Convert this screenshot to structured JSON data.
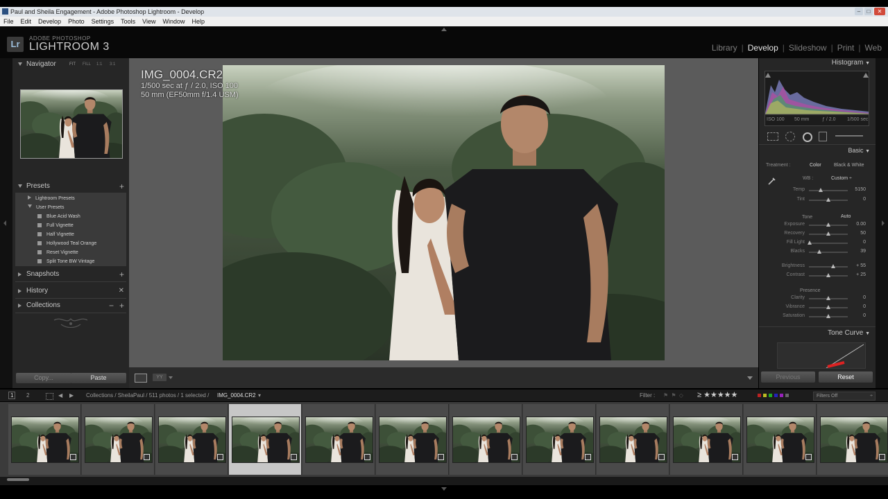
{
  "window": {
    "title": "Paul and Sheila Engagement - Adobe Photoshop Lightroom - Develop",
    "controls": [
      "–",
      "□",
      "✕"
    ]
  },
  "menu": [
    "File",
    "Edit",
    "Develop",
    "Photo",
    "Settings",
    "Tools",
    "View",
    "Window",
    "Help"
  ],
  "brand": {
    "logo": "Lr",
    "line1": "ADOBE PHOTOSHOP",
    "line2": "LIGHTROOM 3"
  },
  "modules": [
    {
      "label": "Library",
      "active": false
    },
    {
      "label": "Develop",
      "active": true
    },
    {
      "label": "Slideshow",
      "active": false
    },
    {
      "label": "Print",
      "active": false
    },
    {
      "label": "Web",
      "active": false
    }
  ],
  "left": {
    "navigator": {
      "title": "Navigator",
      "zoom_options": [
        "FIT",
        "FILL",
        "1:1",
        "3:1"
      ]
    },
    "presets": {
      "title": "Presets",
      "folders": [
        "Lightroom Presets",
        "User Presets"
      ],
      "items": [
        "Blue Acid Wash",
        "Full Vignette",
        "Half Vignette",
        "Hollywood Teal Orange",
        "Reset Vignette",
        "Split Tone BW Vintage"
      ]
    },
    "snapshots": "Snapshots",
    "history": "History",
    "collections": "Collections",
    "copy": "Copy...",
    "paste": "Paste"
  },
  "photo": {
    "filename": "IMG_0004.CR2",
    "exposure": "1/500 sec at ƒ / 2.0, ISO 100",
    "lens": "50 mm (EF50mm f/1.4 USM)"
  },
  "right": {
    "histogram": {
      "title": "Histogram",
      "iso": "ISO 100",
      "focal": "50 mm",
      "aperture": "ƒ / 2.0",
      "shutter": "1/500 sec"
    },
    "basic": {
      "title": "Basic",
      "treatment_label": "Treatment :",
      "treatment_color": "Color",
      "treatment_bw": "Black & White",
      "wb_label": "WB :",
      "wb_value": "Custom ÷",
      "tone_label": "Tone",
      "auto": "Auto",
      "presence_label": "Presence",
      "sliders": [
        {
          "label": "Temp",
          "value": "5150",
          "pos": 0.3
        },
        {
          "label": "Tint",
          "value": "0",
          "pos": 0.5
        },
        {
          "label": "Exposure",
          "value": "0.00",
          "pos": 0.5
        },
        {
          "label": "Recovery",
          "value": "50",
          "pos": 0.5
        },
        {
          "label": "Fill Light",
          "value": "0",
          "pos": 0.02
        },
        {
          "label": "Blacks",
          "value": "39",
          "pos": 0.27
        },
        {
          "label": "Brightness",
          "value": "+ 55",
          "pos": 0.62
        },
        {
          "label": "Contrast",
          "value": "+ 25",
          "pos": 0.5
        },
        {
          "label": "Clarity",
          "value": "0",
          "pos": 0.5
        },
        {
          "label": "Vibrance",
          "value": "0",
          "pos": 0.5
        },
        {
          "label": "Saturation",
          "value": "0",
          "pos": 0.5
        }
      ]
    },
    "tone_curve": "Tone Curve",
    "previous": "Previous",
    "reset": "Reset"
  },
  "filmbar": {
    "view1": "1",
    "view2": "2",
    "breadcrumb": "Collections / SheilaPaul / 511 photos / 1 selected /",
    "current": "IMG_0004.CR2",
    "filter_label": "Filter :",
    "filters_off": "Filters Off"
  },
  "filmstrip": {
    "count": 12,
    "selected_index": 3
  },
  "colors": {
    "panel": "#262626",
    "canvas": "#5b5b5b",
    "filmstrip": "#3b3b3b"
  }
}
